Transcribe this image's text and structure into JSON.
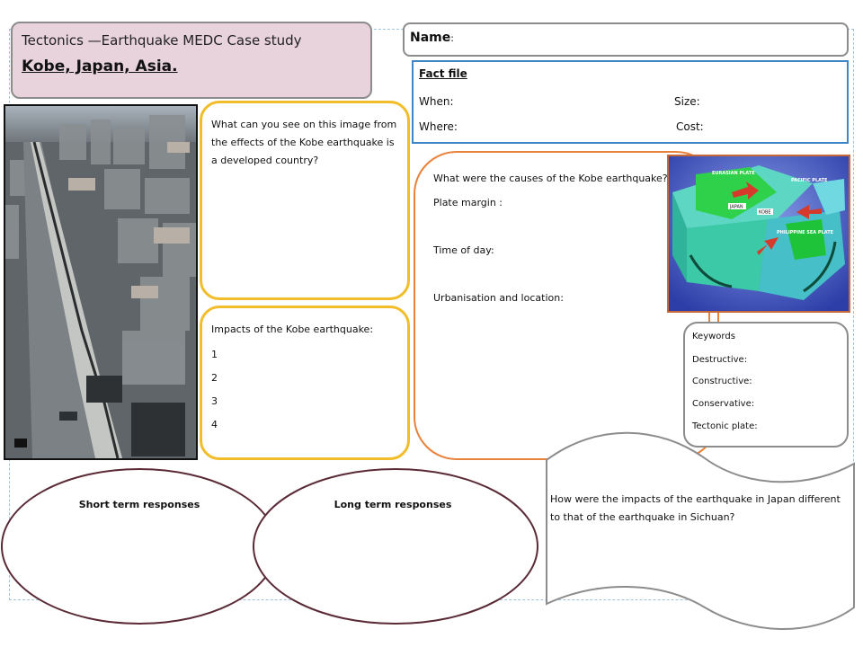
{
  "title": {
    "line1": "Tectonics —Earthquake MEDC Case study",
    "line2": "Kobe, Japan, Asia."
  },
  "name": {
    "label": "Name",
    "suffix": ":"
  },
  "fact_file": {
    "title": "Fact file",
    "when": "When:",
    "where": "Where:",
    "size": "Size:",
    "cost": "Cost:"
  },
  "image_question": "What can you see on this image from the effects of the Kobe earthquake is a developed country?",
  "impacts": {
    "title": "Impacts of the Kobe earthquake:",
    "items": [
      "1",
      "2",
      "3",
      "4"
    ]
  },
  "causes": {
    "title": "What were the causes of the Kobe earthquake?",
    "plate_margin": "Plate margin :",
    "time_of_day": "Time of day:",
    "urbanisation": "Urbanisation and location:"
  },
  "diagram": {
    "labels": [
      "EURASIAN PLATE",
      "PACIFIC PLATE",
      "PHILIPPINE SEA PLATE",
      "JAPAN",
      "KOBE"
    ]
  },
  "keywords": {
    "title": "Keywords",
    "destructive": "Destructive:",
    "constructive": "Constructive:",
    "conservative": "Conservative:",
    "tectonic_plate": "Tectonic plate:"
  },
  "responses": {
    "short_term": "Short term responses",
    "long_term": "Long term responses"
  },
  "comparison_question": "How were the impacts of the earthquake in Japan different to that of the earthquake in Sichuan?",
  "colors": {
    "title_bg": "#e8d3dc",
    "fact_border": "#3f86c7",
    "yellow_border": "#f1bd2a",
    "orange_border": "#e8823a",
    "ellipse_border": "#5a2a36",
    "grey_border": "#8c8c8c"
  },
  "icons": {
    "photo": "earthquake-damage-photo",
    "diagram": "tectonic-plates-diagram"
  }
}
